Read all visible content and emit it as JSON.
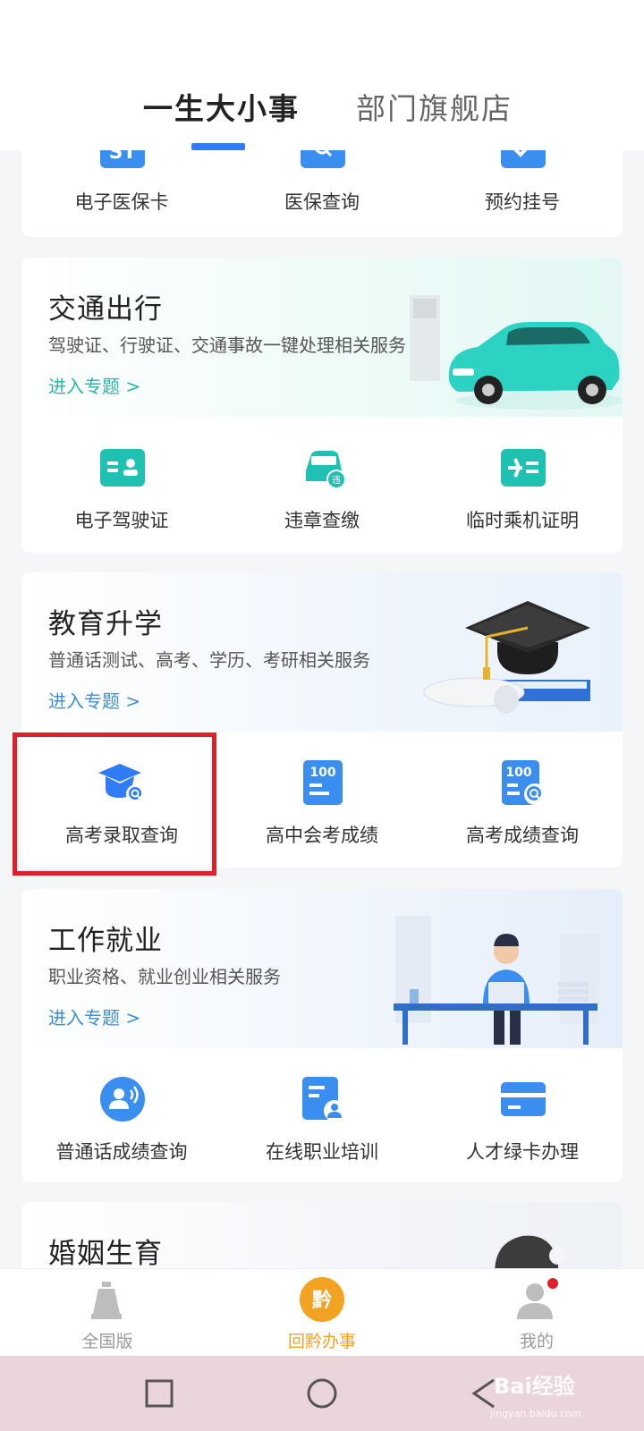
{
  "tabs": {
    "life": "一生大小事",
    "dept": "部门旗舰店"
  },
  "accent": "#2f7cf6",
  "card_medical": {
    "items": [
      {
        "label": "电子医保卡",
        "icon": "medical-card-icon"
      },
      {
        "label": "医保查询",
        "icon": "medical-search-icon"
      },
      {
        "label": "预约挂号",
        "icon": "appointment-check-icon"
      }
    ]
  },
  "card_traffic": {
    "title": "交通出行",
    "desc": "驾驶证、行驶证、交通事故一键处理相关服务",
    "link": "进入专题 >",
    "link_color": "#25b8a8",
    "items": [
      {
        "label": "电子驾驶证",
        "icon": "driver-license-icon"
      },
      {
        "label": "违章查缴",
        "icon": "violation-car-icon"
      },
      {
        "label": "临时乘机证明",
        "icon": "flight-certificate-icon"
      }
    ]
  },
  "card_edu": {
    "title": "教育升学",
    "desc": "普通话测试、高考、学历、考研相关服务",
    "link": "进入专题 >",
    "link_color": "#3b8fd8",
    "items": [
      {
        "label": "高考录取查询",
        "icon": "graduation-cap-search-icon"
      },
      {
        "label": "高中会考成绩",
        "icon": "score-100-icon",
        "badge": "100"
      },
      {
        "label": "高考成绩查询",
        "icon": "score-search-icon",
        "badge": "100"
      }
    ]
  },
  "card_job": {
    "title": "工作就业",
    "desc": "职业资格、就业创业相关服务",
    "link": "进入专题 >",
    "link_color": "#3b8fd8",
    "items": [
      {
        "label": "普通话成绩查询",
        "icon": "speech-user-icon"
      },
      {
        "label": "在线职业培训",
        "icon": "training-doc-icon"
      },
      {
        "label": "人才绿卡办理",
        "icon": "green-card-icon"
      }
    ]
  },
  "card_marriage": {
    "title": "婚姻生育"
  },
  "bottom_nav": [
    {
      "label": "全国版",
      "icon": "national-icon"
    },
    {
      "label": "回黔办事",
      "icon": "guizhou-logo-icon",
      "logo_text": "黔"
    },
    {
      "label": "我的",
      "icon": "user-profile-icon"
    }
  ],
  "watermark": {
    "main": "Bai经验",
    "sub": "jingyan.baidu.com"
  }
}
